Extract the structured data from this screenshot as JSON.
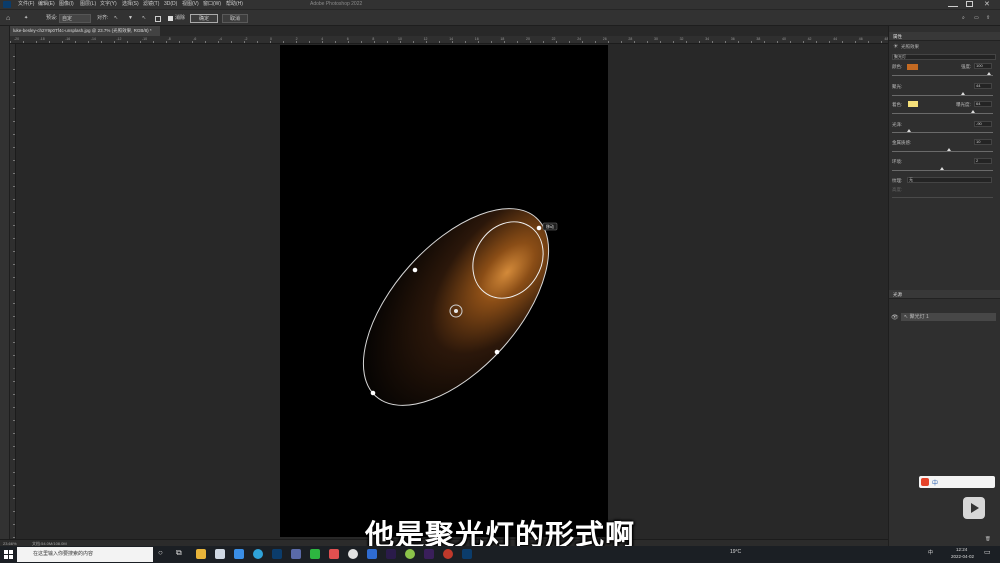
{
  "app": {
    "title": "Adobe Photoshop 2022",
    "menus": [
      "文件(F)",
      "编辑(E)",
      "图像(I)",
      "图层(L)",
      "文字(Y)",
      "选择(S)",
      "滤镜(T)",
      "3D(D)",
      "视图(V)",
      "窗口(W)",
      "帮助(H)"
    ]
  },
  "options_bar": {
    "preset_label": "预设:",
    "preset_value": "自定",
    "align_label": "对齐:",
    "checkbox_label": "消除",
    "ok_label": "确定",
    "cancel_label": "取消"
  },
  "document": {
    "tab_label": "luke-besley-ch2Y9p0Tf4c-unsplash.jpg @ 23.7% (光照效果, RGB/8) *",
    "zoom": "23.66%",
    "doc_info": "文档:54.0M/108.0M"
  },
  "ruler": {
    "numbers": [
      "-20",
      "-18",
      "-16",
      "-14",
      "-12",
      "-10",
      "-8",
      "-6",
      "-4",
      "-2",
      "0",
      "2",
      "4",
      "6",
      "8",
      "10",
      "12",
      "14",
      "16",
      "18",
      "20",
      "22",
      "24",
      "26",
      "28",
      "30",
      "32",
      "34",
      "36",
      "38",
      "40",
      "42",
      "44",
      "46",
      "48"
    ]
  },
  "canvas": {
    "tooltip": "移动"
  },
  "properties_panel": {
    "title": "属性",
    "subtitle": "光照效果",
    "light_type": "聚光灯",
    "color_label": "颜色:",
    "color_value": "#c46a22",
    "intensity_label": "强度:",
    "intensity_value": "100",
    "hotspot_label": "聚光:",
    "hotspot_value": "44",
    "coloring_label": "着色:",
    "coloring_value": "#f5e07a",
    "exposure_label": "曝光度:",
    "exposure_value": "64",
    "gloss_label": "光泽:",
    "gloss_value": "-90",
    "metallic_label": "金属质感:",
    "metallic_value": "10",
    "ambience_label": "环境:",
    "ambience_value": "2",
    "texture_label": "纹理:",
    "texture_value": "无",
    "height_label": "高度:"
  },
  "lights_panel": {
    "title": "光源",
    "items": [
      {
        "label": "聚光灯 1"
      }
    ]
  },
  "subtitle": "他是聚光灯的形式啊",
  "taskbar": {
    "search_placeholder": "在这里输入你要搜索的内容",
    "weather": "19°C",
    "ime": "中",
    "time": "12:24",
    "date": "2022-04-02"
  }
}
